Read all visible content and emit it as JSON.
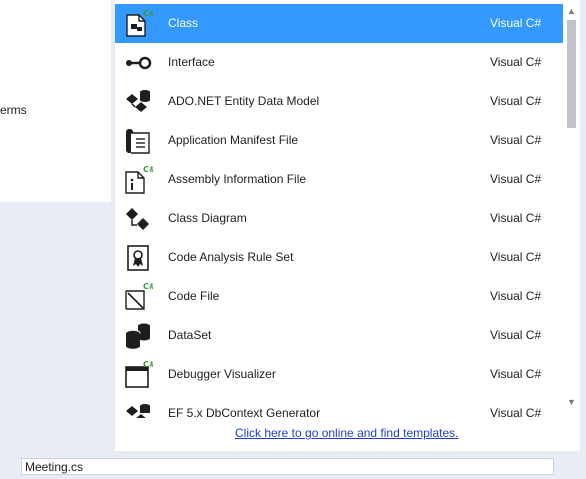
{
  "left_panel": {
    "partial_text": "erms"
  },
  "templates": [
    {
      "name": "Class",
      "language": "Visual C#",
      "icon": "class-icon",
      "selected": true
    },
    {
      "name": "Interface",
      "language": "Visual C#",
      "icon": "interface-icon"
    },
    {
      "name": "ADO.NET Entity Data Model",
      "language": "Visual C#",
      "icon": "entity-model-icon"
    },
    {
      "name": "Application Manifest File",
      "language": "Visual C#",
      "icon": "manifest-icon"
    },
    {
      "name": "Assembly Information File",
      "language": "Visual C#",
      "icon": "assembly-info-icon"
    },
    {
      "name": "Class Diagram",
      "language": "Visual C#",
      "icon": "class-diagram-icon"
    },
    {
      "name": "Code Analysis Rule Set",
      "language": "Visual C#",
      "icon": "rule-set-icon"
    },
    {
      "name": "Code File",
      "language": "Visual C#",
      "icon": "code-file-icon"
    },
    {
      "name": "DataSet",
      "language": "Visual C#",
      "icon": "dataset-icon"
    },
    {
      "name": "Debugger Visualizer",
      "language": "Visual C#",
      "icon": "debugger-visualizer-icon"
    },
    {
      "name": "EF 5.x DbContext Generator",
      "language": "Visual C#",
      "icon": "dbcontext-generator-icon"
    }
  ],
  "csharp_badge": "C#",
  "footer": {
    "online_link": "Click here to go online and find templates."
  },
  "name_field": {
    "value": "Meeting.cs"
  },
  "colors": {
    "selection": "#3399ff",
    "link": "#1e3fcc",
    "badge": "#3a9a3a"
  }
}
